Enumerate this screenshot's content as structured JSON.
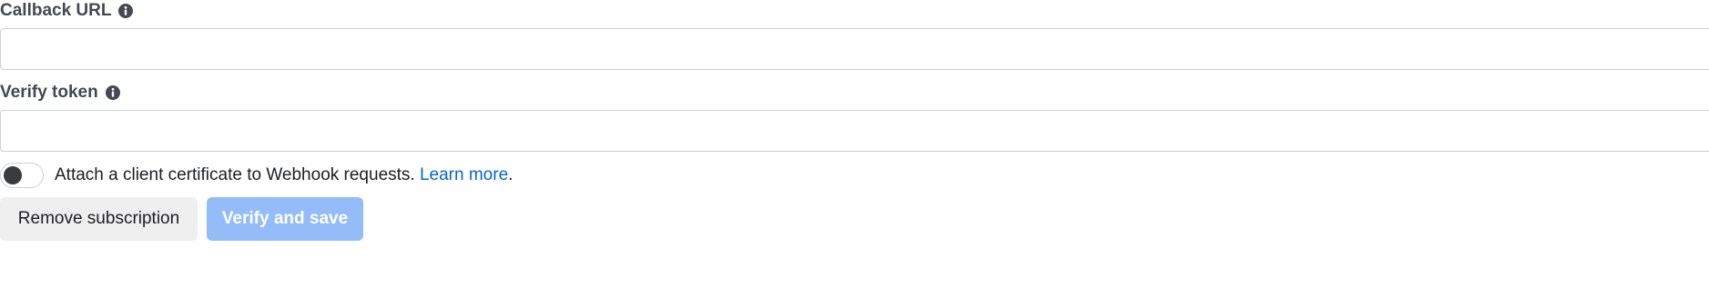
{
  "callback_url": {
    "label": "Callback URL",
    "info_icon": "info-circle-icon",
    "value": "",
    "placeholder": ""
  },
  "verify_token": {
    "label": "Verify token",
    "info_icon": "info-circle-icon",
    "value": "",
    "placeholder": ""
  },
  "client_certificate": {
    "toggle_state": "off",
    "text": "Attach a client certificate to Webhook requests.",
    "link_text": "Learn more",
    "trailing_punctuation": "."
  },
  "actions": {
    "remove_label": "Remove subscription",
    "verify_label": "Verify and save",
    "verify_enabled": false
  },
  "colors": {
    "link": "#0a66c2",
    "primary_disabled_bg": "#93bcf8",
    "secondary_bg": "#efefef",
    "input_border": "#ccd0d5",
    "label": "#444950",
    "toggle_knob": "#3a3b3c"
  }
}
